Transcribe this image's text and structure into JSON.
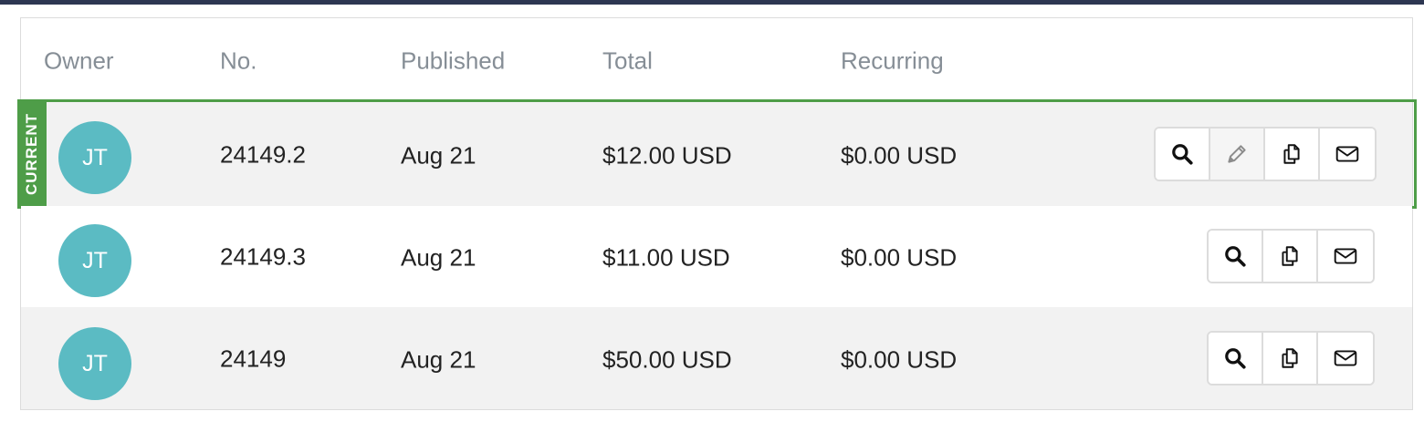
{
  "table": {
    "headers": {
      "owner": "Owner",
      "no": "No.",
      "published": "Published",
      "total": "Total",
      "recurring": "Recurring"
    },
    "current_label": "CURRENT",
    "rows": [
      {
        "owner_initials": "JT",
        "no": "24149.2",
        "published": "Aug 21",
        "total": "$12.00 USD",
        "recurring": "$0.00 USD",
        "is_current": true,
        "actions": [
          "search-icon",
          "pencil-icon",
          "copy-icon",
          "envelope-icon"
        ]
      },
      {
        "owner_initials": "JT",
        "no": "24149.3",
        "published": "Aug 21",
        "total": "$11.00 USD",
        "recurring": "$0.00 USD",
        "is_current": false,
        "actions": [
          "search-icon",
          "copy-icon",
          "envelope-icon"
        ]
      },
      {
        "owner_initials": "JT",
        "no": "24149",
        "published": "Aug 21",
        "total": "$50.00 USD",
        "recurring": "$0.00 USD",
        "is_current": false,
        "actions": [
          "search-icon",
          "copy-icon",
          "envelope-icon"
        ]
      }
    ]
  },
  "colors": {
    "top_bar": "#2d3752",
    "current_green": "#4e9d48",
    "avatar_teal": "#5bbbc3",
    "row_stripe": "#f2f2f2"
  }
}
